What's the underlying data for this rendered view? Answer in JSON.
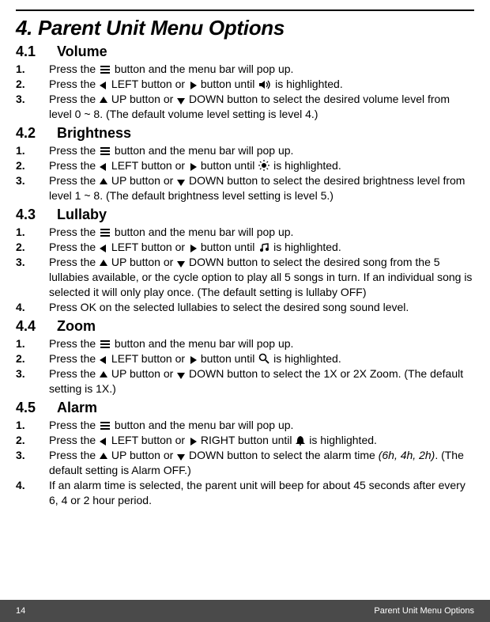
{
  "title": "4. Parent Unit Menu Options",
  "sections": [
    {
      "num": "4.1",
      "title": "Volume",
      "steps": [
        "Press the [menu] button and the menu bar will pop up.",
        "Press the [left] LEFT button or [right] button until [volume] is highlighted.",
        "Press the [up] UP button or [down] DOWN button to select the desired volume level from level 0 ~ 8. (The default volume level setting is level 4.)"
      ]
    },
    {
      "num": "4.2",
      "title": "Brightness",
      "steps": [
        "Press the [menu] button and the menu bar will pop up.",
        "Press the [left] LEFT button or [right] button until [brightness] is highlighted.",
        "Press the [up] UP button or [down] DOWN button to select the desired brightness level from level 1 ~ 8. (The default brightness level setting is level 5.)"
      ]
    },
    {
      "num": "4.3",
      "title": "Lullaby",
      "steps": [
        "Press the [menu] button and the menu bar will pop up.",
        "Press the [left] LEFT button or [right] button until [music] is highlighted.",
        "Press the [up] UP button or [down] DOWN button to select the desired song from the 5 lullabies available, or the cycle option to play all 5 songs in turn. If an individual song is selected it will only play once. (The default setting is lullaby OFF)",
        "Press OK on the selected lullabies to select the desired song sound level."
      ]
    },
    {
      "num": "4.4",
      "title": "Zoom",
      "steps": [
        "Press the [menu] button and the menu bar will pop up.",
        "Press the [left] LEFT button or [right] button until [zoom] is highlighted.",
        "Press the [up] UP button or [down] DOWN button to select the 1X or 2X Zoom. (The default setting is 1X.)"
      ]
    },
    {
      "num": "4.5",
      "title": "Alarm",
      "steps": [
        "Press the [menu] button and the menu bar will pop up.",
        "Press the [left] LEFT button or [right] RIGHT button until [alarm] is highlighted.",
        "Press the [up] UP button or [down] DOWN button to select the alarm time (6h, 4h, 2h). (The default setting is Alarm OFF.)",
        "If an alarm time is selected, the parent unit will beep for about 45 seconds after every 6, 4 or 2 hour period."
      ]
    }
  ],
  "footer": {
    "page": "14",
    "title": "Parent Unit Menu Options"
  },
  "icons": {
    "menu": "menu-icon",
    "left": "triangle-left-icon",
    "right": "triangle-right-icon",
    "up": "triangle-up-icon",
    "down": "triangle-down-icon",
    "volume": "speaker-icon",
    "brightness": "sun-icon",
    "music": "music-note-icon",
    "zoom": "magnifier-icon",
    "alarm": "bell-icon"
  }
}
